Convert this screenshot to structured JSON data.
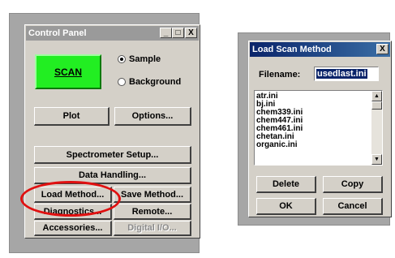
{
  "control_panel": {
    "title": "Control Panel",
    "window_buttons": [
      "_",
      "□",
      "X"
    ],
    "scan_label": "SCAN",
    "radio_sample": "Sample",
    "radio_background": "Background",
    "plot_label": "Plot",
    "options_label": "Options...",
    "spectrometer_setup_label": "Spectrometer Setup...",
    "data_handling_label": "Data Handling...",
    "load_method_label": "Load Method...",
    "save_method_label": "Save Method...",
    "diagnostics_label": "Diagnostics...",
    "remote_label": "Remote...",
    "accessories_label": "Accessories...",
    "digital_io_label": "Digital I/O..."
  },
  "load_scan_method": {
    "title": "Load Scan Method",
    "close": "X",
    "filename_label": "Filename:",
    "filename_value": "usedlast.ini",
    "files": [
      "atr.ini",
      "bj.ini",
      "chem339.ini",
      "chem447.ini",
      "chem461.ini",
      "chetan.ini",
      "organic.ini"
    ],
    "delete_label": "Delete",
    "copy_label": "Copy",
    "ok_label": "OK",
    "cancel_label": "Cancel"
  },
  "colors": {
    "scan_green": "#22ee22",
    "highlight_ring": "#e01010",
    "selection": "#0a246a"
  }
}
